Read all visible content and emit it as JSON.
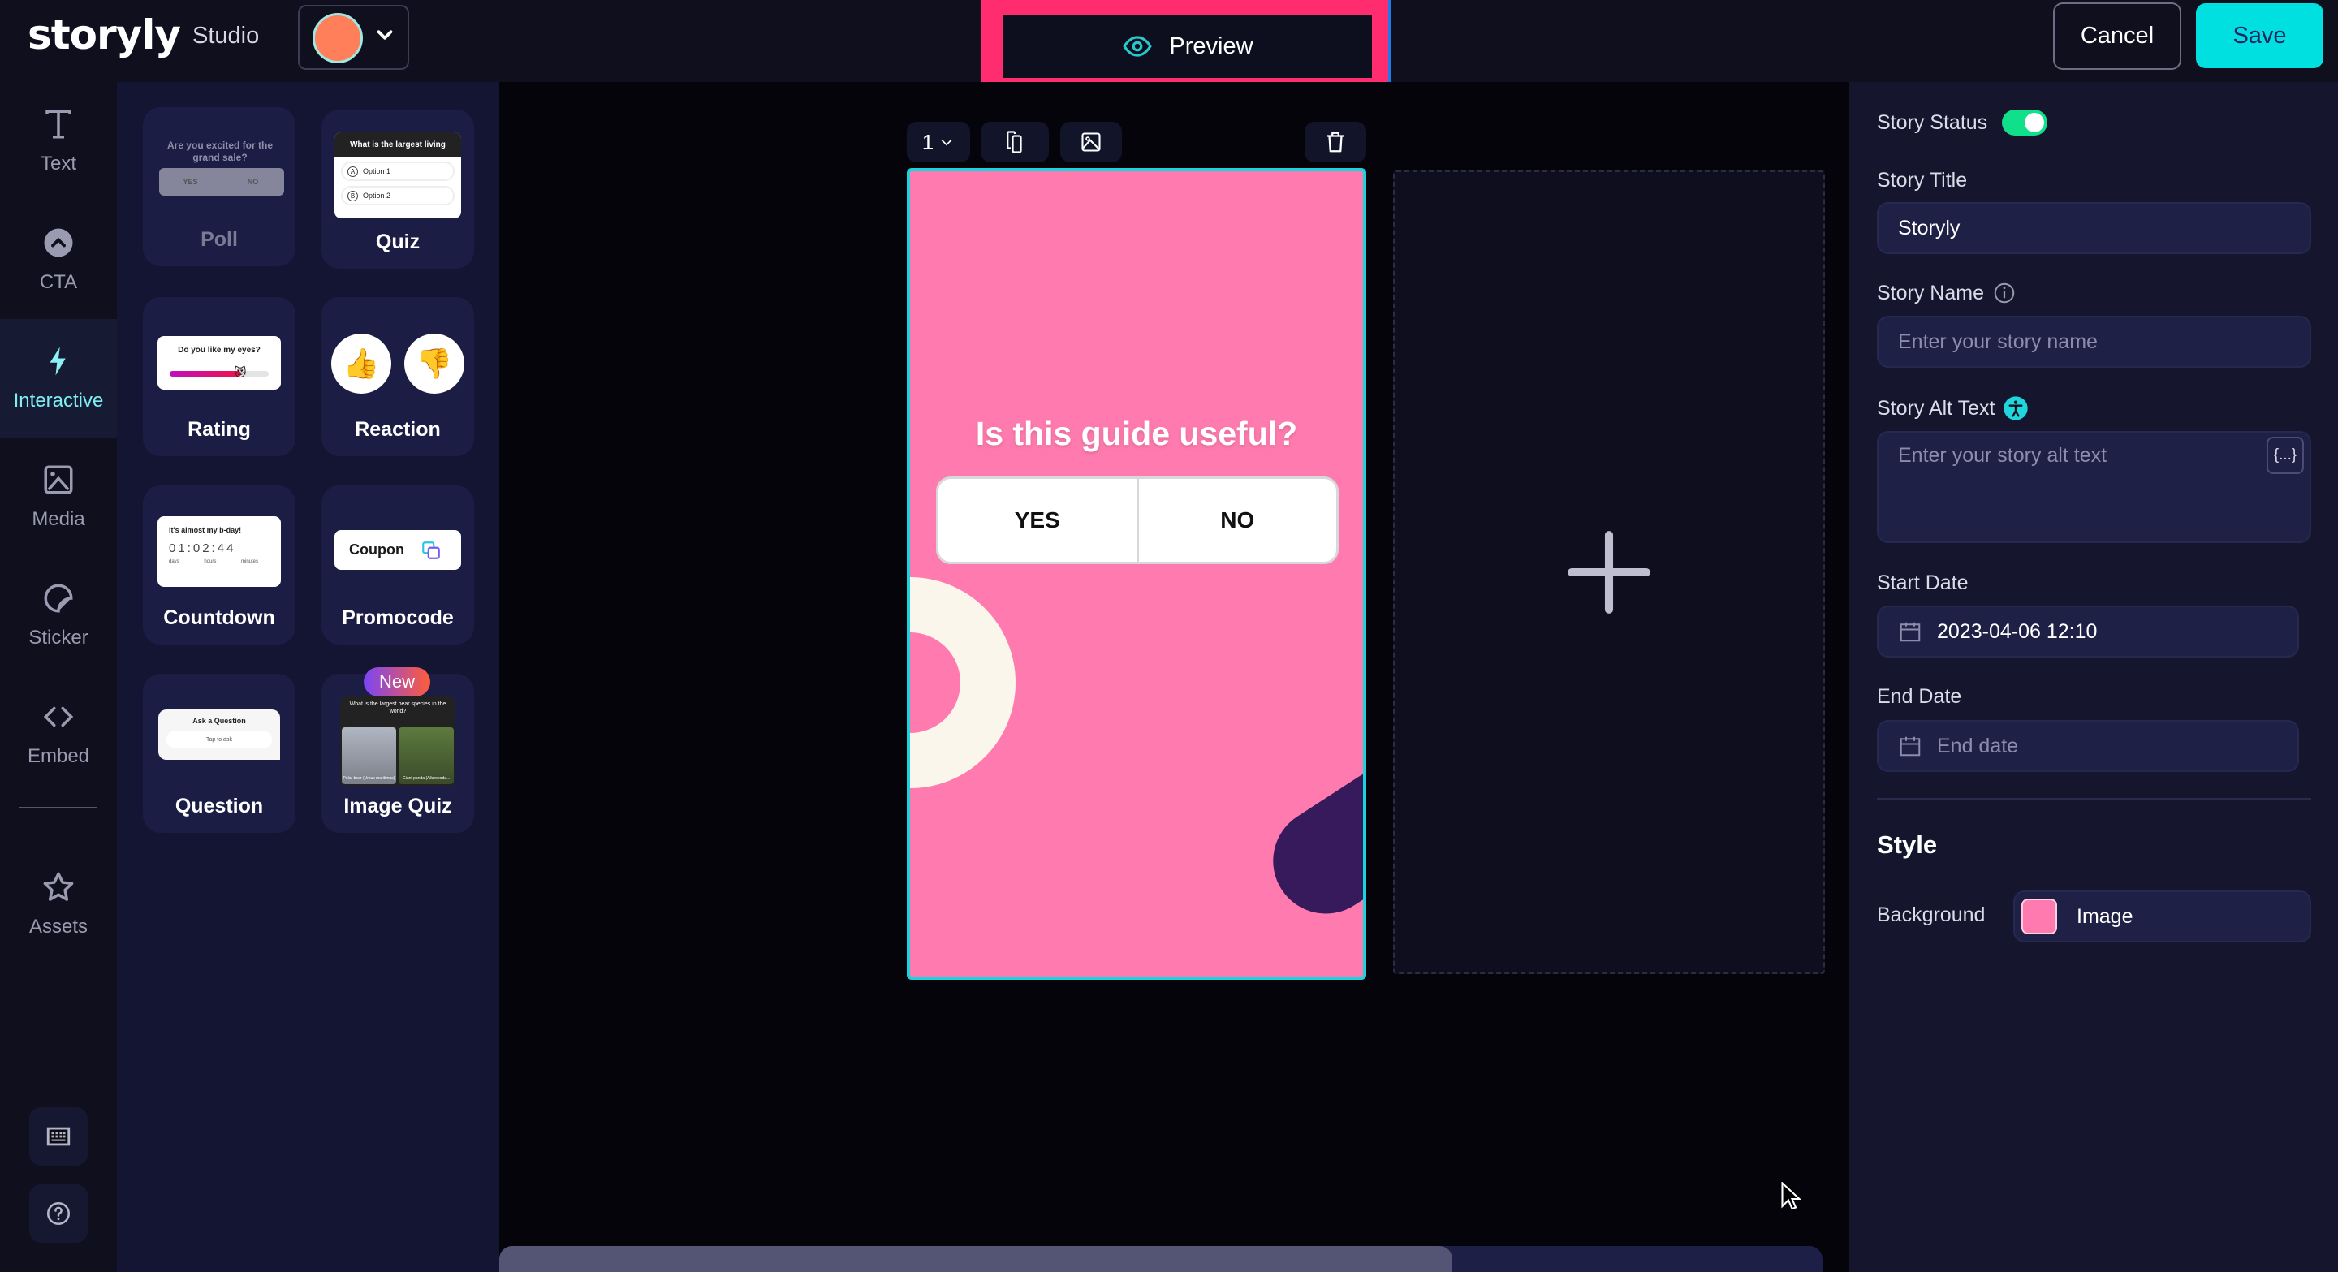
{
  "header": {
    "logo": "storyly",
    "product": "Studio",
    "avatar_color": "#ff7f5a",
    "preview_label": "Preview",
    "cancel_label": "Cancel",
    "save_label": "Save"
  },
  "leftnav": {
    "items": [
      {
        "label": "Text",
        "icon": "text-icon"
      },
      {
        "label": "CTA",
        "icon": "chevron-up-circle-icon"
      },
      {
        "label": "Interactive",
        "icon": "lightning-icon",
        "active": true
      },
      {
        "label": "Media",
        "icon": "image-icon"
      },
      {
        "label": "Sticker",
        "icon": "sticker-icon"
      },
      {
        "label": "Embed",
        "icon": "code-icon"
      },
      {
        "label": "Assets",
        "icon": "star-icon"
      }
    ],
    "bottom": [
      "keyboard-icon",
      "help-icon"
    ]
  },
  "widgets": {
    "items": [
      {
        "label": "Poll",
        "disabled": true,
        "thumb": {
          "question": "Are you excited for the grand sale?",
          "yes": "YES",
          "no": "NO"
        }
      },
      {
        "label": "Quiz",
        "thumb": {
          "question": "What is the largest living",
          "options": [
            "Option 1",
            "Option 2"
          ],
          "letters": [
            "A",
            "B"
          ]
        }
      },
      {
        "label": "Rating",
        "thumb": {
          "question": "Do you like my eyes?",
          "emoji": "😻",
          "value": 0.72
        }
      },
      {
        "label": "Reaction",
        "thumb": {
          "up": "👍",
          "down": "👎"
        }
      },
      {
        "label": "Countdown",
        "thumb": {
          "title": "It's almost my b-day!",
          "digits": [
            "0",
            "1",
            "0",
            "2",
            "4",
            "4"
          ],
          "units": [
            "days",
            "hours",
            "minutes"
          ]
        }
      },
      {
        "label": "Promocode",
        "thumb": {
          "code": "Coupon"
        }
      },
      {
        "label": "Question",
        "thumb": {
          "title": "Ask a Question",
          "placeholder": "Tap to ask"
        }
      },
      {
        "label": "Image Quiz",
        "badge": "New",
        "thumb": {
          "question": "What is the largest bear species in the world?",
          "options": [
            "Polar bear (Ursus maritimus)",
            "Giant panda (Ailuropoda..."
          ],
          "letters": [
            "A",
            "B"
          ]
        }
      }
    ]
  },
  "canvas": {
    "page_number": "1",
    "story": {
      "question": "Is this guide useful?",
      "options": [
        "YES",
        "NO"
      ],
      "background_color": "#ff7baf"
    },
    "scroll_position": 0.72
  },
  "rpanel": {
    "status_label": "Story Status",
    "status_on": true,
    "title_label": "Story Title",
    "title_value": "Storyly",
    "name_label": "Story Name",
    "name_placeholder": "Enter your story name",
    "alt_label": "Story Alt Text",
    "alt_placeholder": "Enter your story alt text",
    "alt_var_button": "{...}",
    "start_label": "Start Date",
    "start_value": "2023-04-06 12:10",
    "end_label": "End Date",
    "end_placeholder": "End date",
    "style_title": "Style",
    "background_label": "Background",
    "background_value": "Image"
  }
}
